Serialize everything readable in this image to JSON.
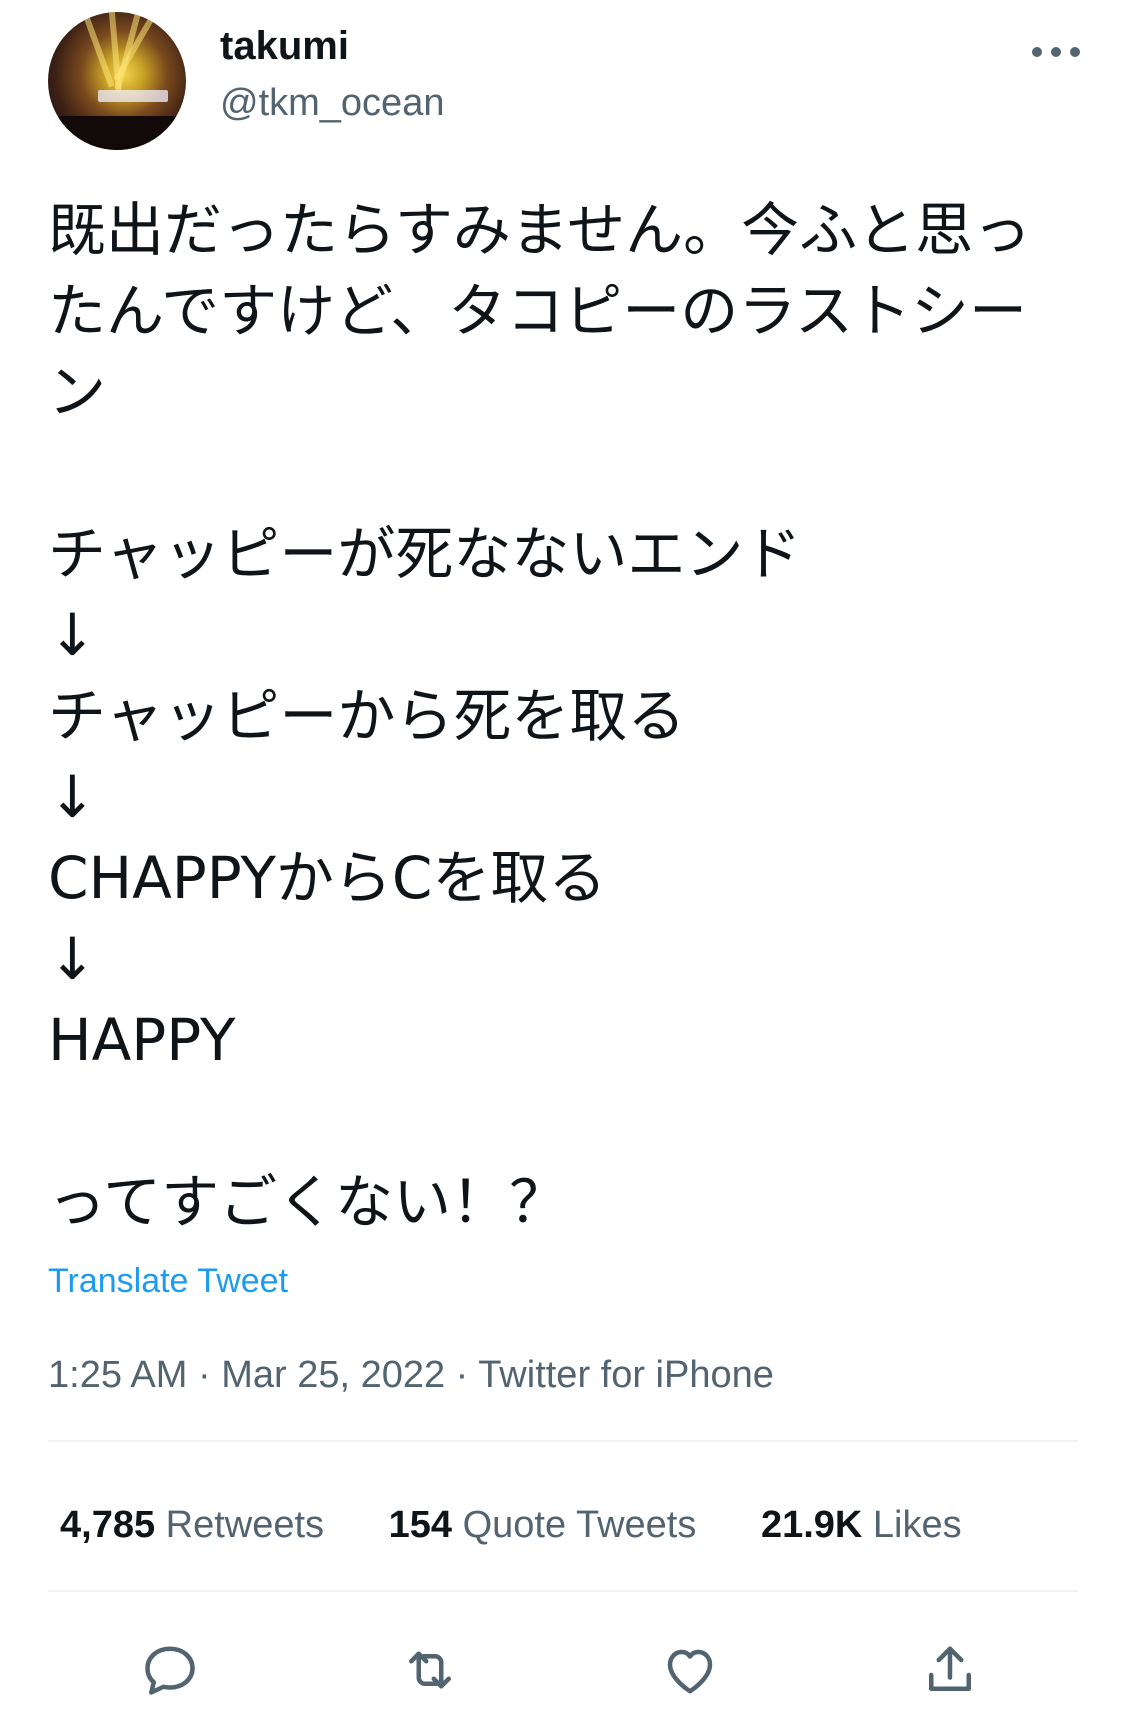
{
  "user": {
    "display_name": "takumi",
    "handle": "@tkm_ocean",
    "avatar_icon": "concert-stage-avatar"
  },
  "tweet": {
    "text": "既出だったらすみません。今ふと思ったんですけど、タコピーのラストシーン\n\nチャッピーが死なないエンド\n↓\nチャッピーから死を取る\n↓\nCHAPPYからCを取る\n↓\nHAPPY\n\nってすごくない！？",
    "translate_label": "Translate Tweet",
    "meta": "1:25 AM · Mar 25, 2022 · Twitter for iPhone"
  },
  "stats": {
    "retweets_count": "4,785",
    "retweets_label": "Retweets",
    "quotes_count": "154",
    "quotes_label": "Quote Tweets",
    "likes_count": "21.9K",
    "likes_label": "Likes"
  },
  "actions": {
    "reply_icon": "reply-icon",
    "retweet_icon": "retweet-icon",
    "like_icon": "heart-icon",
    "share_icon": "share-icon"
  },
  "colors": {
    "link": "#1d9bf0",
    "secondary_text": "#536471",
    "primary_text": "#0f1419",
    "divider": "#eff3f4"
  }
}
